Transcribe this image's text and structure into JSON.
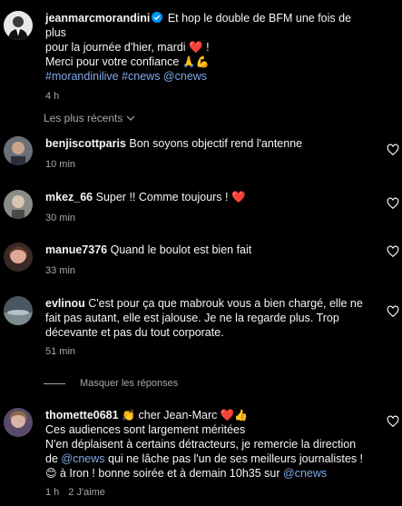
{
  "post": {
    "username": "jeanmarcmorandini",
    "text_line1": "Et hop le double de BFM une fois de plus",
    "text_line2": "pour la journée d'hier, mardi",
    "text_line2_suffix": "!",
    "text_line3": "Merci pour votre confiance",
    "hashtags": "#morandinilive #cnews @cnews",
    "time": "4 h",
    "verified_color": "#0095f6"
  },
  "sort_label": "Les plus récents",
  "comments": [
    {
      "username": "benjiscottparis",
      "text": "Bon soyons objectif rend l'antenne",
      "time": "10 min"
    },
    {
      "username": "mkez_66",
      "text": "Super !! Comme toujours !",
      "time": "30 min"
    },
    {
      "username": "manue7376",
      "text": "Quand le boulot est bien fait",
      "time": "33 min"
    },
    {
      "username": "evlinou",
      "text_line1": "C'est pour ça que mabrouk vous a bien chargé, elle ne",
      "text_line2": "fait pas autant, elle est jalouse. Je ne la regarde plus. Trop",
      "text_line3": "décevante et pas du tout corporate.",
      "time": "51 min"
    },
    {
      "username": "thomette0681",
      "text_line1": "cher Jean-Marc",
      "text_line2": "Ces audiences sont largement méritées",
      "text_line3": "N'en déplaisent à certains détracteurs, je remercie la direction",
      "text_line4_prefix": "de",
      "text_line4_link": "@cnews",
      "text_line4_suffix": "qui ne lâche pas l'un de ses meilleurs journalistes !",
      "text_line5_prefix": "à Iron ! bonne soirée et à demain 10h35 sur",
      "text_line5_link": "@cnews",
      "time": "1 h",
      "likes": "2 J'aime"
    }
  ],
  "replies_label": "Masquer les réponses"
}
